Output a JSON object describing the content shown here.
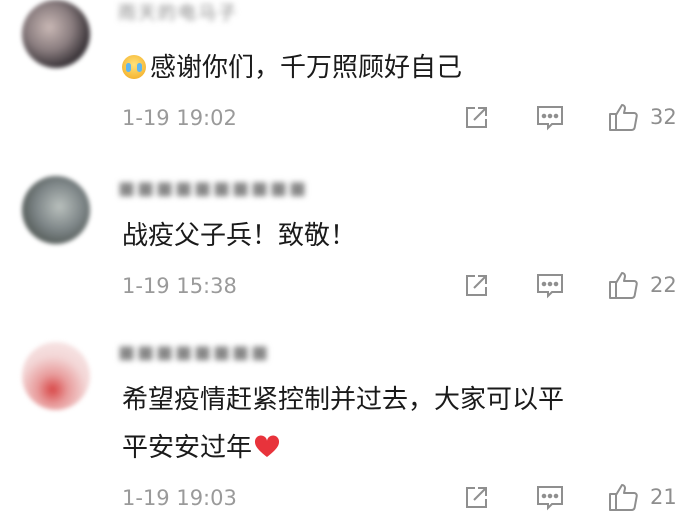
{
  "comments": [
    {
      "username": "雨天的电马子",
      "text": "感谢你们，千万照顾好自己",
      "emoji": "crying-face-emoji",
      "timestamp": "1-19 19:02",
      "likes": "32"
    },
    {
      "username": "■■■■■■■■■■",
      "text": "战疫父子兵！致敬！",
      "timestamp": "1-19 15:38",
      "likes": "22"
    },
    {
      "username": "■■■■■■■■",
      "text_line1": "希望疫情赶紧控制并过去，大家可以平",
      "text_line2": "平安安过年",
      "emoji": "red-heart-emoji",
      "timestamp": "1-19 19:03",
      "likes": "21"
    }
  ],
  "icons": {
    "share": "share-icon",
    "comment": "comment-icon",
    "like": "thumbs-up-icon"
  },
  "colors": {
    "heart": "#e8333b",
    "icon_gray": "#8f8f8f"
  }
}
